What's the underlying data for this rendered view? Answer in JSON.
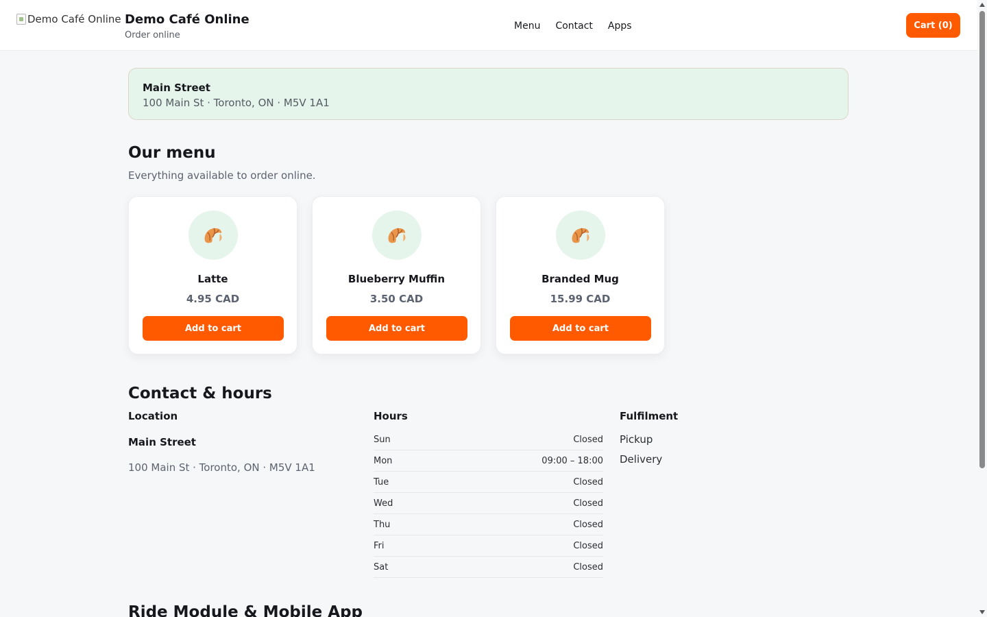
{
  "header": {
    "logo_alt": "Demo Café Online",
    "brand_name": "Demo Café Online",
    "brand_sub": "Order online",
    "nav": [
      {
        "label": "Menu"
      },
      {
        "label": "Contact"
      },
      {
        "label": "Apps"
      }
    ],
    "cart_label": "Cart (0)"
  },
  "location_banner": {
    "name": "Main Street",
    "address": "100 Main St · Toronto, ON · M5V 1A1"
  },
  "menu": {
    "title": "Our menu",
    "subtitle": "Everything available to order online.",
    "items": [
      {
        "icon": "croissant-icon",
        "name": "Latte",
        "price": "4.95 CAD",
        "button": "Add to cart"
      },
      {
        "icon": "croissant-icon",
        "name": "Blueberry Muffin",
        "price": "3.50 CAD",
        "button": "Add to cart"
      },
      {
        "icon": "croissant-icon",
        "name": "Branded Mug",
        "price": "15.99 CAD",
        "button": "Add to cart"
      }
    ]
  },
  "contact": {
    "title": "Contact & hours",
    "location_heading": "Location",
    "location_name": "Main Street",
    "location_address": "100 Main St · Toronto, ON · M5V 1A1",
    "hours_heading": "Hours",
    "hours": [
      {
        "day": "Sun",
        "time": "Closed"
      },
      {
        "day": "Mon",
        "time": "09:00 – 18:00"
      },
      {
        "day": "Tue",
        "time": "Closed"
      },
      {
        "day": "Wed",
        "time": "Closed"
      },
      {
        "day": "Thu",
        "time": "Closed"
      },
      {
        "day": "Fri",
        "time": "Closed"
      },
      {
        "day": "Sat",
        "time": "Closed"
      }
    ],
    "fulfilment_heading": "Fulfilment",
    "fulfilment": [
      "Pickup",
      "Delivery"
    ]
  },
  "next_section_title": "Ride Module & Mobile App",
  "colors": {
    "accent": "#ff5a00",
    "mint": "#e6f5ec"
  }
}
